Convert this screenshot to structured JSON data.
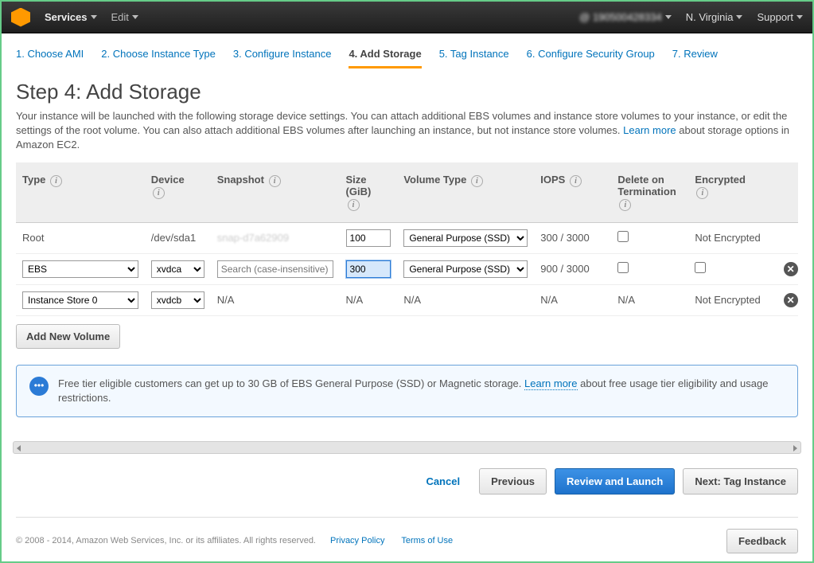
{
  "topbar": {
    "services": "Services",
    "edit": "Edit",
    "account": "@ 190500428334",
    "region": "N. Virginia",
    "support": "Support"
  },
  "steps": [
    "1. Choose AMI",
    "2. Choose Instance Type",
    "3. Configure Instance",
    "4. Add Storage",
    "5. Tag Instance",
    "6. Configure Security Group",
    "7. Review"
  ],
  "active_step_index": 3,
  "heading": "Step 4: Add Storage",
  "description": "Your instance will be launched with the following storage device settings. You can attach additional EBS volumes and instance store volumes to your instance, or edit the settings of the root volume. You can also attach additional EBS volumes after launching an instance, but not instance store volumes.",
  "learn_more": "Learn more",
  "description_tail": " about storage options in Amazon EC2.",
  "columns": {
    "type": "Type",
    "device": "Device",
    "snapshot": "Snapshot",
    "size": "Size (GiB)",
    "volume_type": "Volume Type",
    "iops": "IOPS",
    "delete_on_term": "Delete on Termination",
    "encrypted": "Encrypted"
  },
  "rows": [
    {
      "type_text": "Root",
      "device_text": "/dev/sda1",
      "snapshot": "snap-d7a62909",
      "size": "100",
      "volume_type_option": "General Purpose (SSD)",
      "iops": "300 / 3000",
      "delete_checked": false,
      "encrypted_text": "Not Encrypted",
      "removable": false,
      "type_is_select": false,
      "device_is_select": false,
      "size_highlight": false,
      "snapshot_is_input": false,
      "row_kind": "root"
    },
    {
      "type_option": "EBS",
      "device_option": "xvdca",
      "snapshot_placeholder": "Search (case-insensitive)",
      "size": "300",
      "volume_type_option": "General Purpose (SSD)",
      "iops": "900 / 3000",
      "delete_checked": false,
      "encrypted_checkbox": false,
      "removable": true,
      "type_is_select": true,
      "device_is_select": true,
      "size_highlight": true,
      "snapshot_is_input": true,
      "row_kind": "ebs"
    },
    {
      "type_option": "Instance Store 0",
      "device_option": "xvdcb",
      "snapshot_text": "N/A",
      "size_text": "N/A",
      "volume_type_text": "N/A",
      "iops": "N/A",
      "delete_text": "N/A",
      "encrypted_text": "Not Encrypted",
      "removable": true,
      "type_is_select": true,
      "device_is_select": true,
      "row_kind": "instance_store"
    }
  ],
  "add_volume": "Add New Volume",
  "info_box": {
    "text1": "Free tier eligible customers can get up to 30 GB of EBS General Purpose (SSD) or Magnetic storage. ",
    "learn_more": "Learn more",
    "text2": " about free usage tier eligibility and usage restrictions."
  },
  "actions": {
    "cancel": "Cancel",
    "previous": "Previous",
    "review": "Review and Launch",
    "next": "Next: Tag Instance"
  },
  "footer": {
    "copyright": "© 2008 - 2014, Amazon Web Services, Inc. or its affiliates. All rights reserved.",
    "privacy": "Privacy Policy",
    "terms": "Terms of Use",
    "feedback": "Feedback"
  }
}
